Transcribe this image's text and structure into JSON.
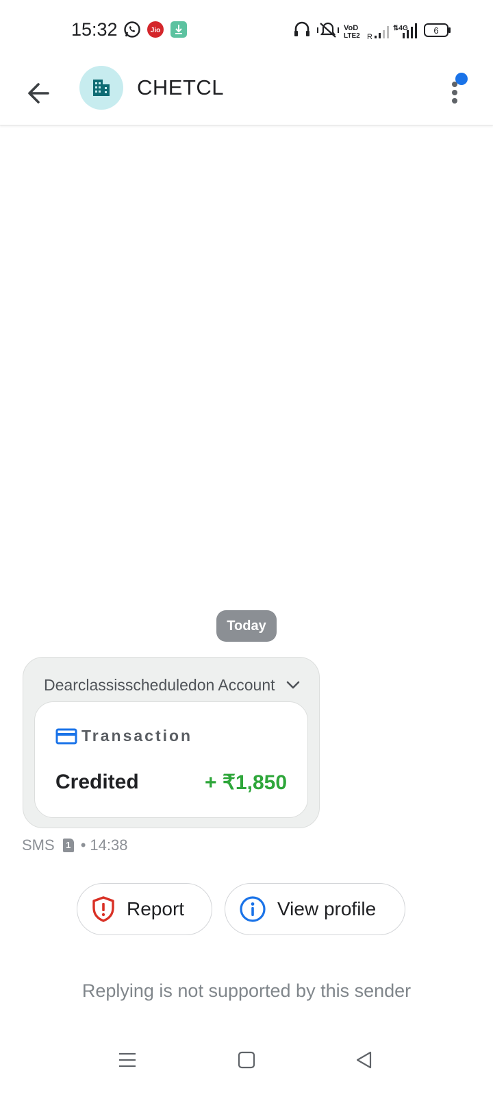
{
  "status_bar": {
    "time": "15:32",
    "battery_level": "6",
    "icons": [
      "whatsapp-icon",
      "jio-icon",
      "download-icon",
      "headphones-icon",
      "vibrate-icon",
      "volte-icon",
      "signal-icon",
      "4g-signal-icon",
      "battery-icon"
    ]
  },
  "app_bar": {
    "contact_name": "CHETCL",
    "avatar_icon": "business-icon",
    "has_notification_dot": true,
    "accent_color": "#1a73e8"
  },
  "conversation": {
    "date_label": "Today",
    "message": {
      "preview": "Dearclassisscheduledon Account",
      "card": {
        "type_label": "Transaction",
        "status": "Credited",
        "amount": "+ ₹1,850",
        "amount_color": "#2ea63a"
      },
      "channel": "SMS",
      "sim": "1",
      "separator": "•",
      "time": "14:38"
    }
  },
  "actions": {
    "report_label": "Report",
    "view_profile_label": "View profile"
  },
  "footer": {
    "reply_note": "Replying is not supported by this sender"
  },
  "nav": [
    "menu-icon",
    "home-icon",
    "back-triangle-icon"
  ]
}
